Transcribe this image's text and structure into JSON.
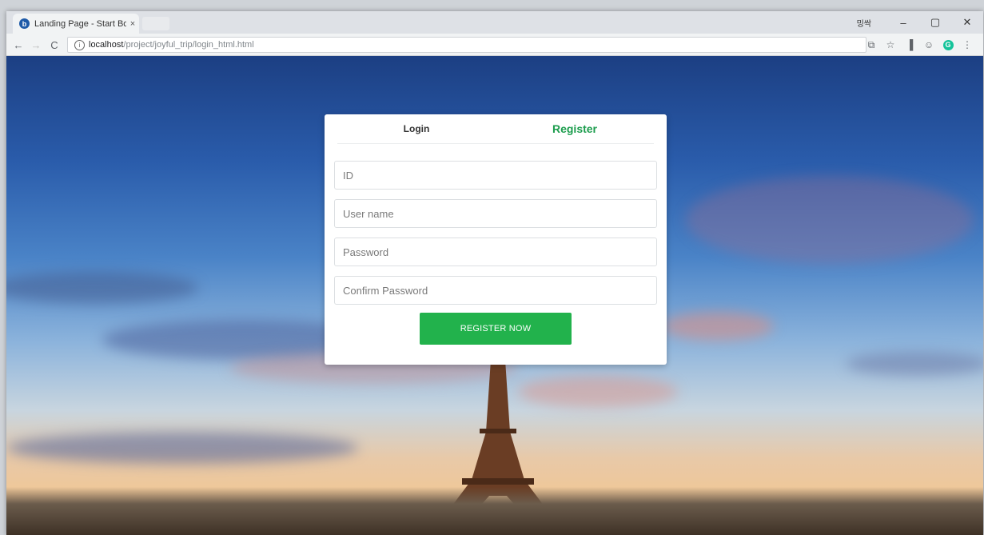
{
  "browser": {
    "tab_title": "Landing Page - Start Bo",
    "tab_close": "×",
    "user_label": "밍싹",
    "minimize": "–",
    "maximize": "▢",
    "close": "✕",
    "back": "←",
    "forward": "→",
    "reload": "C",
    "url_host": "localhost",
    "url_path": "/project/joyful_trip/login_html.html"
  },
  "card": {
    "tabs": [
      {
        "label": "Login"
      },
      {
        "label": "Register"
      }
    ],
    "fields": {
      "id_placeholder": "ID",
      "username_placeholder": "User name",
      "password_placeholder": "Password",
      "confirm_placeholder": "Confirm Password"
    },
    "submit_label": "REGISTER NOW"
  },
  "colors": {
    "accent": "#22b24c",
    "active_tab": "#1d9d4e"
  }
}
